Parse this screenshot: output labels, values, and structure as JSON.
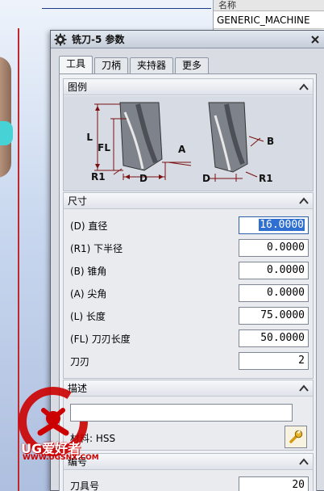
{
  "background": {
    "side_panel": {
      "header": "名称",
      "value": "GENERIC_MACHINE"
    }
  },
  "dialog": {
    "title": "铣刀-5 参数",
    "tabs": [
      {
        "label": "工具",
        "active": true
      },
      {
        "label": "刀柄",
        "active": false
      },
      {
        "label": "夹持器",
        "active": false
      },
      {
        "label": "更多",
        "active": false
      }
    ],
    "legend": {
      "header": "图例",
      "labels": {
        "L": "L",
        "FL": "FL",
        "R1_left": "R1",
        "D_left": "D",
        "A": "A",
        "B": "B",
        "D_right": "D",
        "R1_right": "R1"
      }
    },
    "dimensions": {
      "header": "尺寸",
      "fields": [
        {
          "label": "(D) 直径",
          "value": "16.0000",
          "selected": true
        },
        {
          "label": "(R1) 下半径",
          "value": "0.0000"
        },
        {
          "label": "(B) 锥角",
          "value": "0.0000"
        },
        {
          "label": "(A) 尖角",
          "value": "0.0000"
        },
        {
          "label": "(L) 长度",
          "value": "75.0000"
        },
        {
          "label": "(FL) 刀刃长度",
          "value": "50.0000"
        },
        {
          "label": "刀刃",
          "value": "2"
        }
      ]
    },
    "description": {
      "header": "描述",
      "text_value": "",
      "material": "材料: HSS"
    },
    "numbering": {
      "header": "编号",
      "tool_number_label": "刀具号",
      "tool_number_value": "20"
    }
  },
  "watermark": {
    "brand": "UG爱好者",
    "site": "WWW.UGSNX.COM"
  },
  "colors": {
    "selection": "#2f6fd1",
    "watermark_red": "#cc0000"
  }
}
